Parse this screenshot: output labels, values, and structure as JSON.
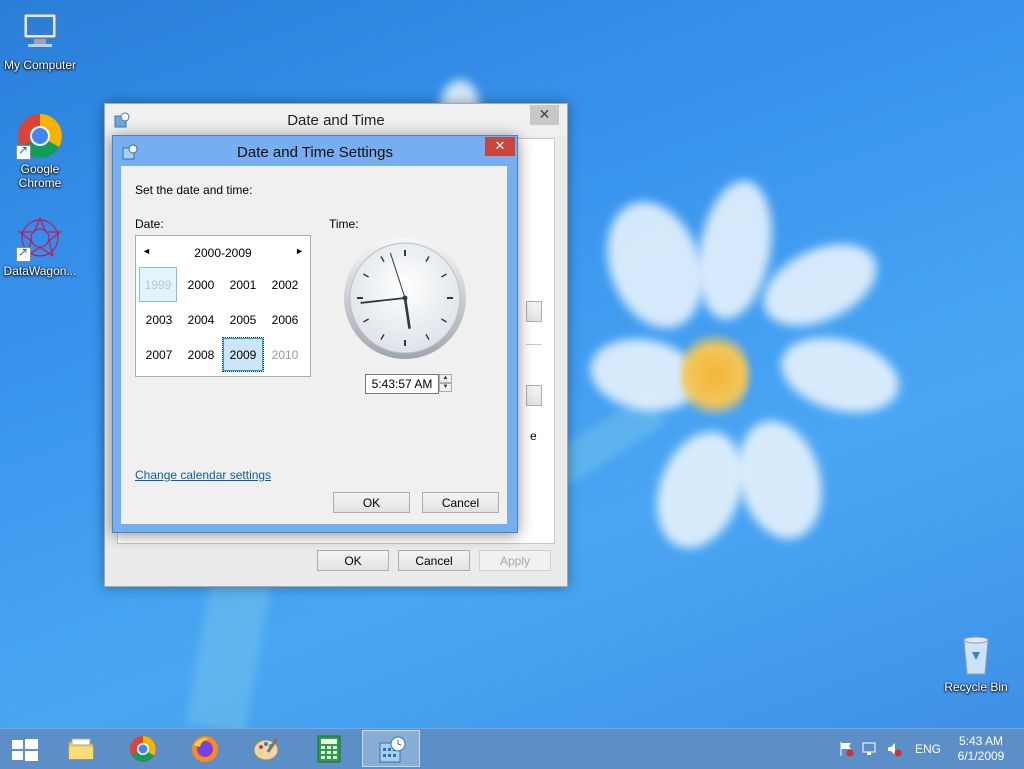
{
  "desktop": {
    "icons": [
      {
        "label": "My Computer"
      },
      {
        "label_line1": "Google",
        "label_line2": "Chrome"
      },
      {
        "label": "DataWagon..."
      },
      {
        "label": "Recycle Bin"
      }
    ]
  },
  "outer_dialog": {
    "title": "Date and Time",
    "close_symbol": "✕",
    "ok_label": "OK",
    "cancel_label": "Cancel",
    "apply_label": "Apply",
    "apply_disabled": true,
    "partial_text": "e"
  },
  "settings_dialog": {
    "title": "Date and Time Settings",
    "close_symbol": "✕",
    "instruction": "Set the date and time:",
    "date_label": "Date:",
    "time_label": "Time:",
    "calendar": {
      "prev_symbol": "◄",
      "next_symbol": "►",
      "header": "2000-2009",
      "years": [
        {
          "label": "1999",
          "state": "hover-dim"
        },
        {
          "label": "2000",
          "state": "normal"
        },
        {
          "label": "2001",
          "state": "normal"
        },
        {
          "label": "2002",
          "state": "normal"
        },
        {
          "label": "2003",
          "state": "normal"
        },
        {
          "label": "2004",
          "state": "normal"
        },
        {
          "label": "2005",
          "state": "normal"
        },
        {
          "label": "2006",
          "state": "normal"
        },
        {
          "label": "2007",
          "state": "normal"
        },
        {
          "label": "2008",
          "state": "normal"
        },
        {
          "label": "2009",
          "state": "selected"
        },
        {
          "label": "2010",
          "state": "dim"
        }
      ]
    },
    "clock": {
      "hour": 5,
      "minute": 43,
      "second": 57
    },
    "time_value": "5:43:57 AM",
    "spin_up": "▲",
    "spin_down": "▼",
    "change_calendar_link": "Change calendar settings",
    "ok_label": "OK",
    "cancel_label": "Cancel"
  },
  "taskbar": {
    "apps": [
      {
        "name": "file-explorer"
      },
      {
        "name": "chrome"
      },
      {
        "name": "firefox"
      },
      {
        "name": "paint"
      },
      {
        "name": "calculator"
      },
      {
        "name": "date-and-time",
        "active": true
      }
    ],
    "tray": {
      "language": "ENG",
      "time": "5:43 AM",
      "date": "6/1/2009"
    }
  },
  "colors": {
    "desktop_blue": "#3a95ee",
    "taskbar": "#5c8fc7",
    "dialog_frame": "#76aef0",
    "close_red": "#c9463d",
    "link": "#0b5fa8",
    "selection": "#cde6f7"
  }
}
